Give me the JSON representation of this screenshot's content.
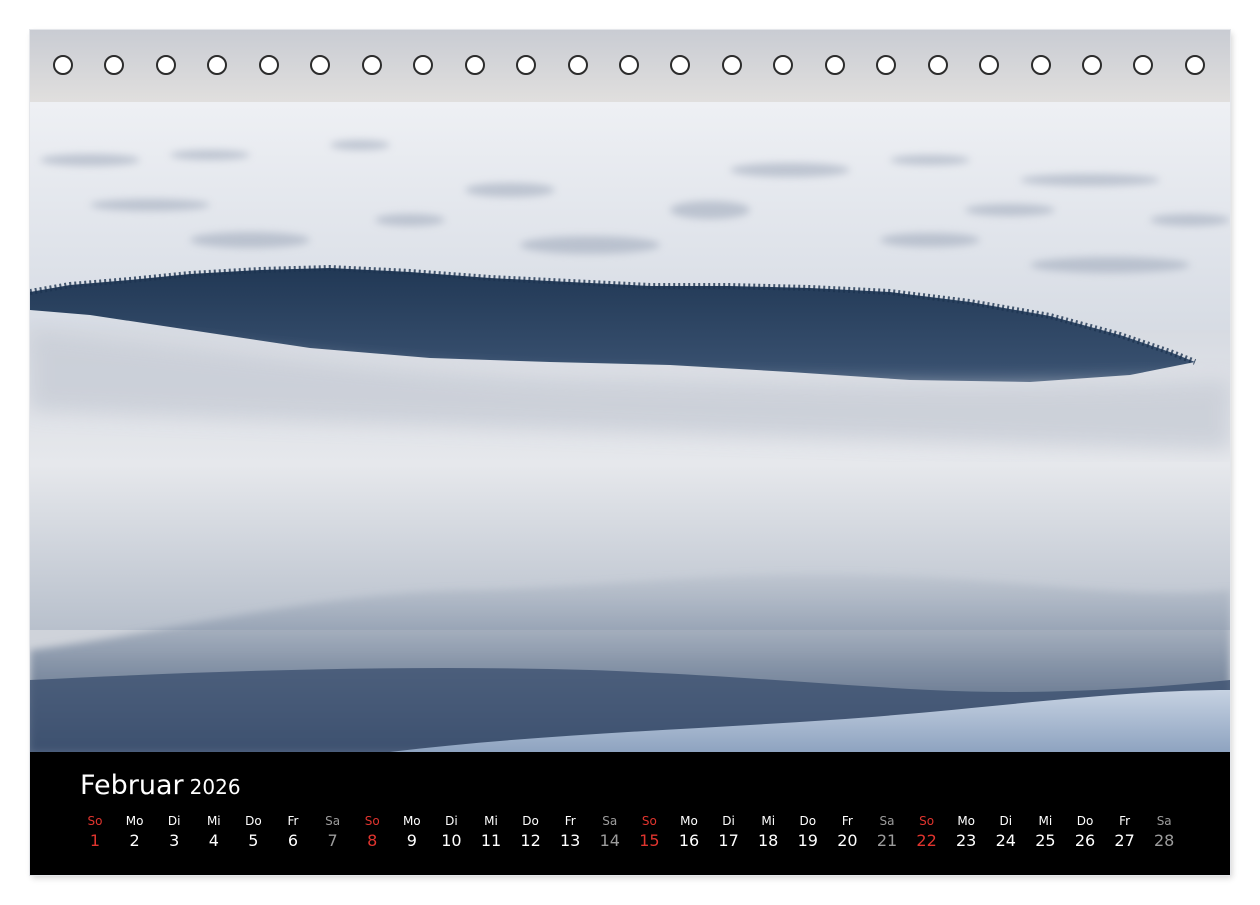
{
  "calendar": {
    "month": "Februar",
    "year": "2026",
    "rings": 23,
    "days": [
      {
        "wd": "So",
        "d": "1",
        "t": "sun"
      },
      {
        "wd": "Mo",
        "d": "2",
        "t": ""
      },
      {
        "wd": "Di",
        "d": "3",
        "t": ""
      },
      {
        "wd": "Mi",
        "d": "4",
        "t": ""
      },
      {
        "wd": "Do",
        "d": "5",
        "t": ""
      },
      {
        "wd": "Fr",
        "d": "6",
        "t": ""
      },
      {
        "wd": "Sa",
        "d": "7",
        "t": "sat"
      },
      {
        "wd": "So",
        "d": "8",
        "t": "sun"
      },
      {
        "wd": "Mo",
        "d": "9",
        "t": ""
      },
      {
        "wd": "Di",
        "d": "10",
        "t": ""
      },
      {
        "wd": "Mi",
        "d": "11",
        "t": ""
      },
      {
        "wd": "Do",
        "d": "12",
        "t": ""
      },
      {
        "wd": "Fr",
        "d": "13",
        "t": ""
      },
      {
        "wd": "Sa",
        "d": "14",
        "t": "sat"
      },
      {
        "wd": "So",
        "d": "15",
        "t": "sun"
      },
      {
        "wd": "Mo",
        "d": "16",
        "t": ""
      },
      {
        "wd": "Di",
        "d": "17",
        "t": ""
      },
      {
        "wd": "Mi",
        "d": "18",
        "t": ""
      },
      {
        "wd": "Do",
        "d": "19",
        "t": ""
      },
      {
        "wd": "Fr",
        "d": "20",
        "t": ""
      },
      {
        "wd": "Sa",
        "d": "21",
        "t": "sat"
      },
      {
        "wd": "So",
        "d": "22",
        "t": "sun"
      },
      {
        "wd": "Mo",
        "d": "23",
        "t": ""
      },
      {
        "wd": "Di",
        "d": "24",
        "t": ""
      },
      {
        "wd": "Mi",
        "d": "25",
        "t": ""
      },
      {
        "wd": "Do",
        "d": "26",
        "t": ""
      },
      {
        "wd": "Fr",
        "d": "27",
        "t": ""
      },
      {
        "wd": "Sa",
        "d": "28",
        "t": "sat"
      }
    ]
  },
  "colors": {
    "sunday": "#e0342e",
    "saturday": "#9c9c9c",
    "weekday": "#ffffff",
    "footer_bg": "#000000"
  }
}
